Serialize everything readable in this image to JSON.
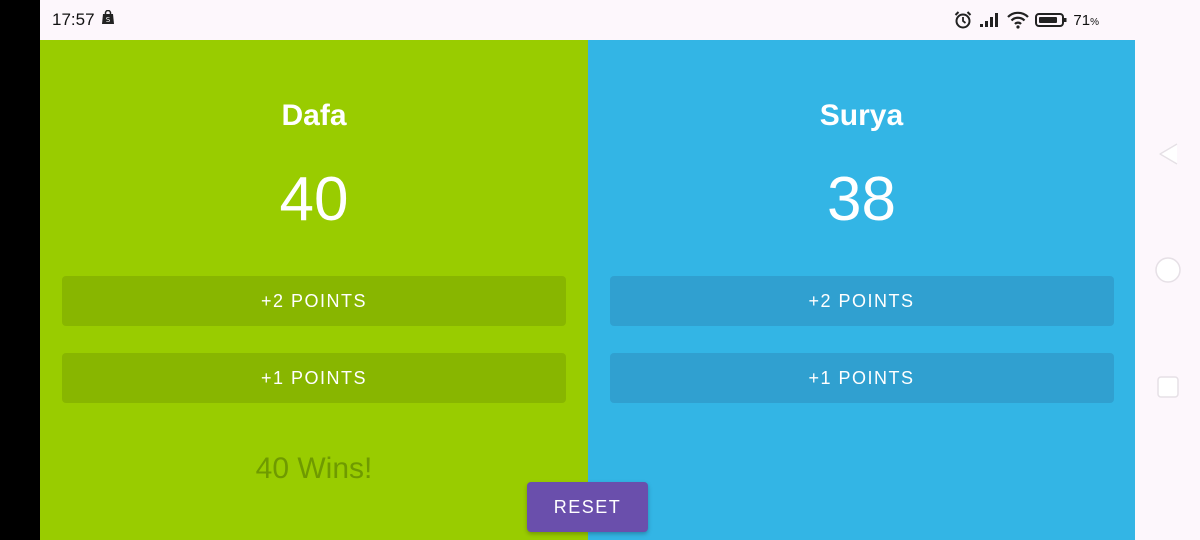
{
  "status_bar": {
    "time": "17:57",
    "battery_percent": "71",
    "battery_unit": "%",
    "icons": [
      "shopping-bag-icon",
      "alarm-icon",
      "signal-icon",
      "wifi-icon",
      "battery-icon"
    ]
  },
  "team_a": {
    "name": "Dafa",
    "score": "40",
    "plus2_label": "+2 POINTS",
    "plus1_label": "+1 POINTS",
    "result_text": "40 Wins!",
    "color": "#99cc00"
  },
  "team_b": {
    "name": "Surya",
    "score": "38",
    "plus2_label": "+2 POINTS",
    "plus1_label": "+1 POINTS",
    "color": "#33b5e5"
  },
  "reset_label": "RESET",
  "accent_color": "#6a4fac",
  "nav": [
    "back-icon",
    "home-icon",
    "recent-apps-icon"
  ]
}
